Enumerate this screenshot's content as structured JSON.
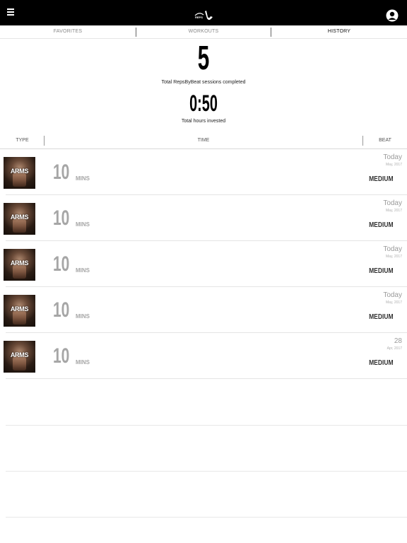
{
  "header": {
    "menu_icon": "hamburger-menu-icon",
    "logo_icon": "repsbybeat-logo-icon",
    "profile_icon": "user-profile-icon"
  },
  "tabs": [
    {
      "label": "FAVORITES",
      "active": false
    },
    {
      "label": "WORKOUTS",
      "active": false
    },
    {
      "label": "HISTORY",
      "active": true
    }
  ],
  "stats": {
    "sessions_value": "5",
    "sessions_label": "Total RepsByBeat sessions completed",
    "hours_value": "0:50",
    "hours_label": "Total hours invested"
  },
  "columns": {
    "type": "TYPE",
    "time": "TIME",
    "beat": "BEAT"
  },
  "rows": [
    {
      "type": "ARMS",
      "minutes": "10",
      "unit": "MINS",
      "day": "Today",
      "month": "May, 2017",
      "beat": "MEDIUM"
    },
    {
      "type": "ARMS",
      "minutes": "10",
      "unit": "MINS",
      "day": "Today",
      "month": "May, 2017",
      "beat": "MEDIUM"
    },
    {
      "type": "ARMS",
      "minutes": "10",
      "unit": "MINS",
      "day": "Today",
      "month": "May, 2017",
      "beat": "MEDIUM"
    },
    {
      "type": "ARMS",
      "minutes": "10",
      "unit": "MINS",
      "day": "Today",
      "month": "May, 2017",
      "beat": "MEDIUM"
    },
    {
      "type": "ARMS",
      "minutes": "10",
      "unit": "MINS",
      "day": "28",
      "month": "Apr, 2017",
      "beat": "MEDIUM"
    }
  ]
}
